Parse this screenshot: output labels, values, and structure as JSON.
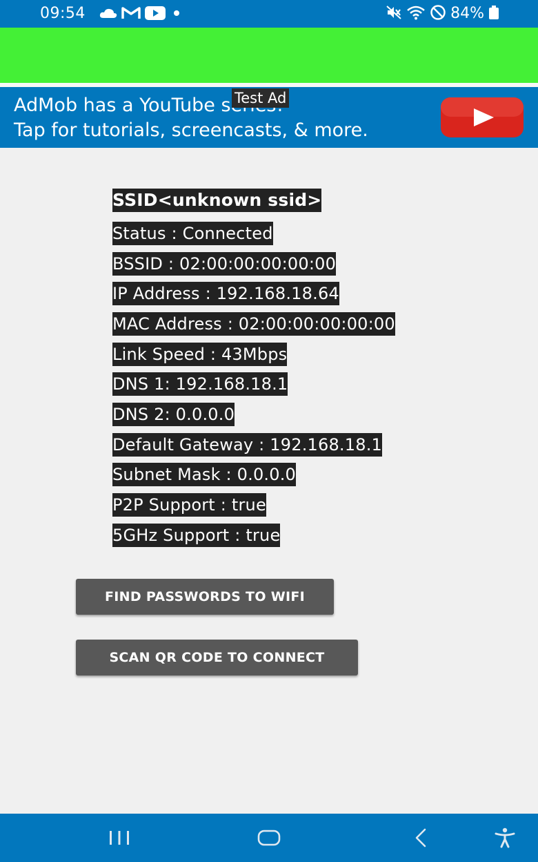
{
  "status_bar": {
    "time": "09:54",
    "battery": "84%",
    "icons_left": [
      "cloud-icon",
      "gmail-icon",
      "youtube-icon",
      "dot-icon"
    ],
    "icons_right": [
      "mute-icon",
      "wifi-icon",
      "dnd-icon",
      "battery-icon"
    ]
  },
  "ad": {
    "line1": "AdMob has a YouTube series!",
    "line2": "Tap for tutorials, screencasts, & more.",
    "badge": "Test Ad",
    "logo_icon": "youtube-logo-icon"
  },
  "wifi_info": {
    "ssid": "SSID<unknown ssid>",
    "status": "Status : Connected",
    "bssid": "BSSID : 02:00:00:00:00:00",
    "ip": "IP Address : 192.168.18.64",
    "mac": "MAC Address : 02:00:00:00:00:00",
    "link_speed": "Link Speed : 43Mbps",
    "dns1": "DNS 1: 192.168.18.1",
    "dns2": "DNS 2: 0.0.0.0",
    "gateway": "Default Gateway : 192.168.18.1",
    "subnet": "Subnet Mask : 0.0.0.0",
    "p2p": "P2P Support : true",
    "ghz5": "5GHz Support : true"
  },
  "buttons": {
    "find_passwords": "FIND PASSWORDS TO WIFI",
    "scan_qr": "SCAN QR CODE TO CONNECT"
  },
  "nav": {
    "items": [
      "recents-icon",
      "home-icon",
      "back-icon",
      "accessibility-icon"
    ]
  },
  "colors": {
    "primary": "#0277bd",
    "ad_green": "#44f036",
    "row_bg": "#222222",
    "button_bg": "#585858",
    "page_bg": "#f0f0f0"
  }
}
